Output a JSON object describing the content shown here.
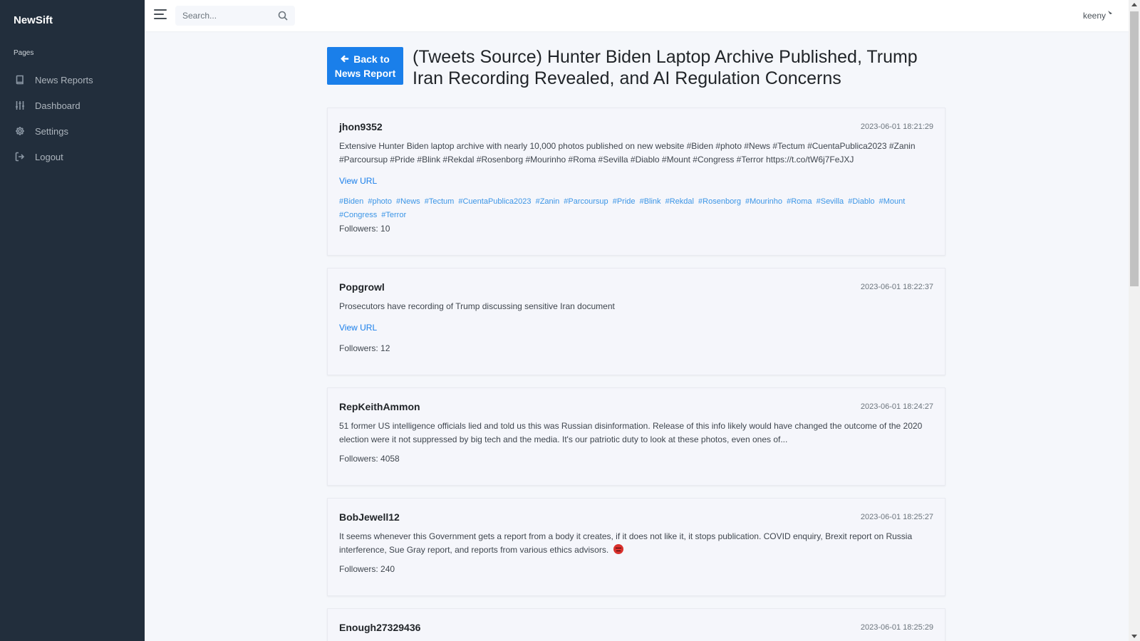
{
  "app": {
    "brand": "NewSift"
  },
  "sidebar": {
    "header": "Pages",
    "items": [
      {
        "label": "News Reports",
        "icon": "book-icon"
      },
      {
        "label": "Dashboard",
        "icon": "sliders-icon"
      },
      {
        "label": "Settings",
        "icon": "gear-icon"
      },
      {
        "label": "Logout",
        "icon": "logout-icon"
      }
    ]
  },
  "topbar": {
    "search_placeholder": "Search...",
    "username": "keeny"
  },
  "main": {
    "back_button_line1": "Back to",
    "back_button_line2": "News Report",
    "title": "(Tweets Source) Hunter Biden Laptop Archive Published, Trump Iran Recording Revealed, and AI Regulation Concerns"
  },
  "tweets": [
    {
      "author": "jhon9352",
      "time": "2023-06-01 18:21:29",
      "text": "Extensive Hunter Biden laptop archive with nearly 10,000 photos published on new website #Biden #photo #News #Tectum #CuentaPublica2023 #Zanin #Parcoursup #Pride #Blink #Rekdal #Rosenborg #Mourinho #Roma #Sevilla #Diablo #Mount #Congress #Terror https://t.co/tW6j7FeJXJ",
      "view_url": "View URL",
      "hashtags": [
        "#Biden",
        "#photo",
        "#News",
        "#Tectum",
        "#CuentaPublica2023",
        "#Zanin",
        "#Parcoursup",
        "#Pride",
        "#Blink",
        "#Rekdal",
        "#Rosenborg",
        "#Mourinho",
        "#Roma",
        "#Sevilla",
        "#Diablo",
        "#Mount",
        "#Congress",
        "#Terror"
      ],
      "followers": "Followers: 10"
    },
    {
      "author": "Popgrowl",
      "time": "2023-06-01 18:22:37",
      "text": "Prosecutors have recording of Trump discussing sensitive Iran document",
      "view_url": "View URL",
      "followers": "Followers: 12"
    },
    {
      "author": "RepKeithAmmon",
      "time": "2023-06-01 18:24:27",
      "text": "51 former US intelligence officials lied and told us this was Russian disinformation. Release of this info likely would have changed the outcome of the 2020 election were it not suppressed by big tech and the media. It's our patriotic duty to look at these photos, even ones of...",
      "followers": "Followers: 4058"
    },
    {
      "author": "BobJewell12",
      "time": "2023-06-01 18:25:27",
      "text": "It seems whenever this Government gets a report from a body it creates, if it does not like it, it stops publication. COVID enquiry, Brexit report on Russia interference, Sue Gray report, and reports from various ethics advisors.",
      "emoji": "angry-face-icon",
      "followers": "Followers: 240"
    },
    {
      "author": "Enough27329436",
      "time": "2023-06-01 18:25:29"
    }
  ]
}
